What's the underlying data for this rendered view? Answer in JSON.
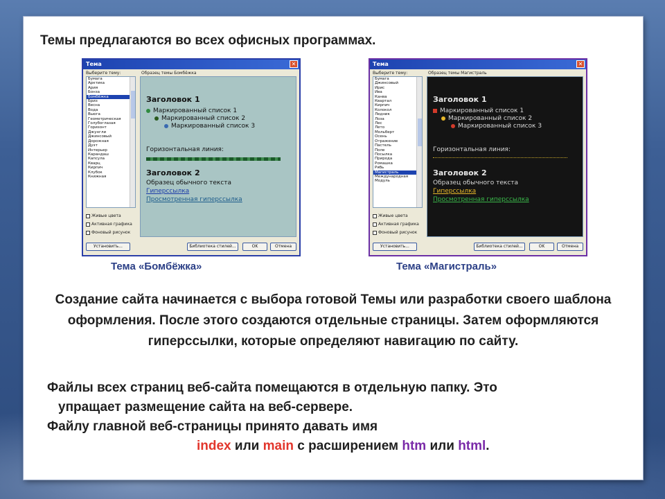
{
  "headline": "Темы предлагаются во всех офисных программах.",
  "dialog_left": {
    "title": "Тема",
    "list_label": "Выберите тему:",
    "preview_label": "Образец темы Бомбёжка",
    "list_items": [
      "Бумага",
      "Арктика",
      "Ария",
      "Бонза",
      "Бомбёжка",
      "Бриз",
      "Весна",
      "Вода",
      "Вьюга",
      "Геометрическая",
      "Голубоглазая",
      "Горизонт",
      "Джунгли",
      "Джинсовый",
      "Дорожная",
      "Дуэт",
      "Интерьер",
      "Карандаш",
      "Капсула",
      "Кварц",
      "Кирпич",
      "Клубок",
      "Книжная"
    ],
    "selected_index": 4,
    "checkboxes": [
      "Живые цвета",
      "Активная графика",
      "Фоновый рисунок"
    ],
    "buttons": {
      "styles": "Установить...",
      "gallery": "Библиотека стилей...",
      "ok": "OK",
      "cancel": "Отмена"
    },
    "preview": {
      "heading1": "Заголовок 1",
      "bullet1": "Маркированный список 1",
      "bullet2": "Маркированный список 2",
      "bullet3": "Маркированный список 3",
      "hr_label": "Горизонтальная линия:",
      "heading2": "Заголовок 2",
      "normal_text": "Образец обычного текста",
      "hyperlink": "Гиперссылка",
      "visited_hyperlink": "Просмотренная гиперссылка"
    },
    "caption": "Тема «Бомбёжка»"
  },
  "dialog_right": {
    "title": "Тема",
    "list_label": "Выберите тему:",
    "preview_label": "Образец темы Магистраль",
    "list_items": [
      "Бумага",
      "Джинсовый",
      "Ирис",
      "Ива",
      "Канва",
      "Квартал",
      "Кирпич",
      "Колокол",
      "Ледник",
      "Лоза",
      "Лес",
      "Лето",
      "Мольберт",
      "Осень",
      "Отражение",
      "Пастель",
      "Поле",
      "Посылка",
      "Природа",
      "Ромашка",
      "Рябь",
      "Магистраль",
      "Международная",
      "Модуль"
    ],
    "selected_index": 21,
    "checkboxes": [
      "Живые цвета",
      "Активная графика",
      "Фоновый рисунок"
    ],
    "buttons": {
      "styles": "Установить...",
      "gallery": "Библиотека стилей...",
      "ok": "OK",
      "cancel": "Отмена"
    },
    "preview": {
      "heading1": "Заголовок 1",
      "bullet1": "Маркированный список 1",
      "bullet2": "Маркированный список 2",
      "bullet3": "Маркированный список 3",
      "hr_label": "Горизонтальная линия:",
      "heading2": "Заголовок 2",
      "normal_text": "Образец обычного текста",
      "hyperlink": "Гиперссылка",
      "visited_hyperlink": "Просмотренная гиперссылка"
    },
    "caption": "Тема «Магистраль»"
  },
  "paragraph1": "Создание сайта начинается с выбора готовой Темы или разработки своего шаблона оформления. После этого создаются отдельные страницы. Затем оформляются гиперссылки, которые определяют навигацию по сайту.",
  "paragraph2": {
    "line1": "Файлы всех страниц веб-сайта помещаются в отдельную папку. Это",
    "line2": "упращает размещение сайта на веб-сервере.",
    "line3": "Файлу главной веб-страницы принято давать имя",
    "name1": "index",
    "or1": " или ",
    "name2": "main",
    "ext_text": " с расширением ",
    "ext1": "htm",
    "or2": " или ",
    "ext2": "html",
    "end": "."
  },
  "colors": {
    "accent_red": "#e2362c",
    "accent_purple": "#7a2aa8",
    "caption_blue": "#2b3f86"
  }
}
